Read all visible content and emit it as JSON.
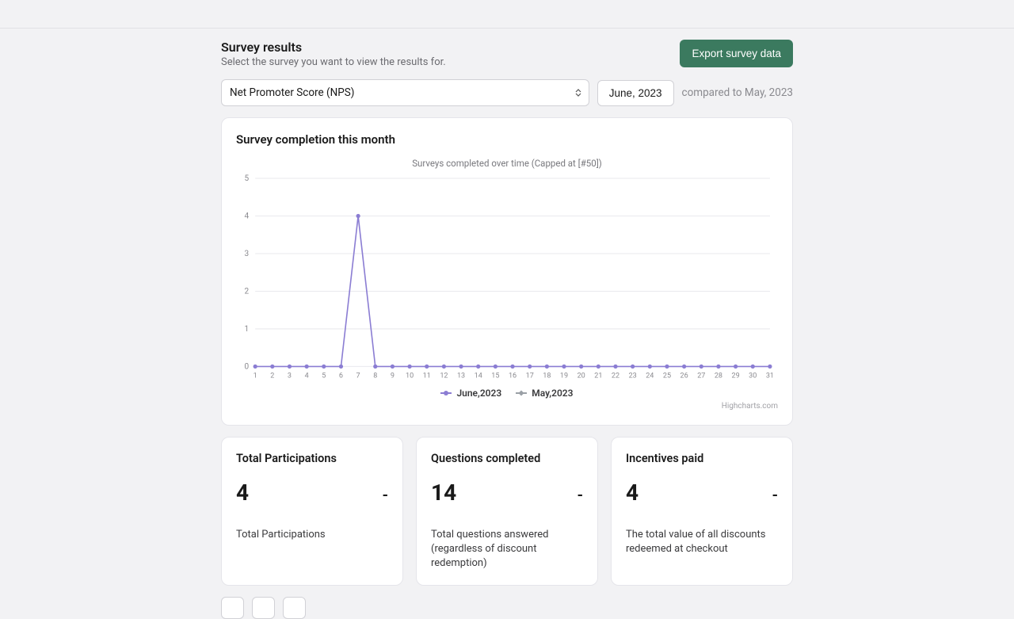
{
  "header": {
    "title": "Survey results",
    "subtitle": "Select the survey you want to view the results for.",
    "export_label": "Export survey data"
  },
  "controls": {
    "survey_selected": "Net Promoter Score (NPS)",
    "month_button": "June, 2023",
    "compared_text": "compared to May, 2023"
  },
  "chart": {
    "panel_title": "Survey completion this month",
    "subtitle": "Surveys completed over time (Capped at [#50])",
    "credits": "Highcharts.com",
    "legend_june": "June,2023",
    "legend_may": "May,2023"
  },
  "chart_data": {
    "type": "line",
    "title": "Surveys completed over time (Capped at [#50])",
    "xlabel": "",
    "ylabel": "",
    "ylim": [
      0,
      5
    ],
    "categories": [
      "1",
      "2",
      "3",
      "4",
      "5",
      "6",
      "7",
      "8",
      "9",
      "10",
      "11",
      "12",
      "13",
      "14",
      "15",
      "16",
      "17",
      "18",
      "19",
      "20",
      "21",
      "22",
      "23",
      "24",
      "25",
      "26",
      "27",
      "28",
      "29",
      "30",
      "31"
    ],
    "series": [
      {
        "name": "June,2023",
        "color": "#8b7dd3",
        "values": [
          0,
          0,
          0,
          0,
          0,
          0,
          4,
          0,
          0,
          0,
          0,
          0,
          0,
          0,
          0,
          0,
          0,
          0,
          0,
          0,
          0,
          0,
          0,
          0,
          0,
          0,
          0,
          0,
          0,
          0,
          0
        ]
      },
      {
        "name": "May,2023",
        "color": "#9aa0a6",
        "values": []
      }
    ],
    "y_ticks": [
      0,
      1,
      2,
      3,
      4,
      5
    ]
  },
  "stats": [
    {
      "title": "Total Participations",
      "value": "4",
      "compare": "-",
      "description": "Total Participations"
    },
    {
      "title": "Questions completed",
      "value": "14",
      "compare": "-",
      "description": "Total questions answered (regardless of discount redemption)"
    },
    {
      "title": "Incentives paid",
      "value": "4",
      "compare": "-",
      "description": "The total value of all discounts redeemed at checkout"
    }
  ]
}
